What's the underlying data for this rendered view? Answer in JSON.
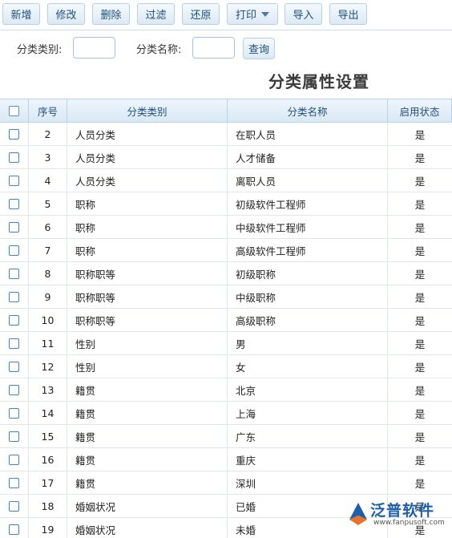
{
  "toolbar": {
    "add": "新增",
    "edit": "修改",
    "delete": "删除",
    "filter": "过滤",
    "restore": "还原",
    "print": "打印",
    "import": "导入",
    "export": "导出"
  },
  "search": {
    "category_label": "分类类别:",
    "name_label": "分类名称:",
    "category_value": "",
    "name_value": "",
    "query_button": "查询"
  },
  "page_title": "分类属性设置",
  "table": {
    "headers": {
      "no": "序号",
      "category": "分类类别",
      "name": "分类名称",
      "status": "启用状态"
    },
    "rows": [
      {
        "no": "2",
        "category": "人员分类",
        "name": "在职人员",
        "status": "是"
      },
      {
        "no": "3",
        "category": "人员分类",
        "name": "人才储备",
        "status": "是"
      },
      {
        "no": "4",
        "category": "人员分类",
        "name": "离职人员",
        "status": "是"
      },
      {
        "no": "5",
        "category": "职称",
        "name": "初级软件工程师",
        "status": "是"
      },
      {
        "no": "6",
        "category": "职称",
        "name": "中级软件工程师",
        "status": "是"
      },
      {
        "no": "7",
        "category": "职称",
        "name": "高级软件工程师",
        "status": "是"
      },
      {
        "no": "8",
        "category": "职称职等",
        "name": "初级职称",
        "status": "是"
      },
      {
        "no": "9",
        "category": "职称职等",
        "name": "中级职称",
        "status": "是"
      },
      {
        "no": "10",
        "category": "职称职等",
        "name": "高级职称",
        "status": "是"
      },
      {
        "no": "11",
        "category": "性别",
        "name": "男",
        "status": "是"
      },
      {
        "no": "12",
        "category": "性别",
        "name": "女",
        "status": "是"
      },
      {
        "no": "13",
        "category": "籍贯",
        "name": "北京",
        "status": "是"
      },
      {
        "no": "14",
        "category": "籍贯",
        "name": "上海",
        "status": "是"
      },
      {
        "no": "15",
        "category": "籍贯",
        "name": "广东",
        "status": "是"
      },
      {
        "no": "16",
        "category": "籍贯",
        "name": "重庆",
        "status": "是"
      },
      {
        "no": "17",
        "category": "籍贯",
        "name": "深圳",
        "status": "是"
      },
      {
        "no": "18",
        "category": "婚姻状况",
        "name": "已婚",
        "status": "是"
      },
      {
        "no": "19",
        "category": "婚姻状况",
        "name": "未婚",
        "status": "是"
      }
    ]
  },
  "watermark": {
    "brand": "泛普软件",
    "url": "www.fanpusoft.com"
  },
  "colors": {
    "accent": "#1f4f7a",
    "header_bg": "#dae8f5",
    "checkbox": "#3f84c4",
    "logo": "#1f5fa8"
  }
}
